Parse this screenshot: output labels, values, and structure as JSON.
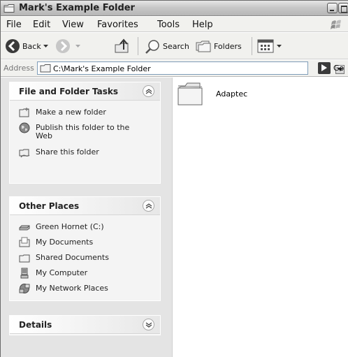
{
  "window": {
    "title": "Mark's Example Folder"
  },
  "menu": {
    "items": [
      "File",
      "Edit",
      "View",
      "Favorites",
      "Tools",
      "Help"
    ]
  },
  "toolbar": {
    "back_label": "Back",
    "search_label": "Search",
    "folders_label": "Folders"
  },
  "address": {
    "label": "Address",
    "path": "C:\\Mark's Example Folder",
    "go_label": "Go"
  },
  "tasks_panel": {
    "title": "File and Folder Tasks",
    "items": [
      {
        "label": "Make a new folder",
        "icon": "new-folder-icon"
      },
      {
        "label": "Publish this folder to the",
        "label2": "Web",
        "icon": "globe-icon"
      },
      {
        "label": "Share this folder",
        "icon": "share-folder-icon"
      }
    ]
  },
  "other_places": {
    "title": "Other Places",
    "items": [
      {
        "label": "Green Hornet (C:)",
        "icon": "drive-icon"
      },
      {
        "label": "My Documents",
        "icon": "my-documents-icon"
      },
      {
        "label": "Shared Documents",
        "icon": "shared-documents-icon"
      },
      {
        "label": "My Computer",
        "icon": "my-computer-icon"
      },
      {
        "label": "My Network Places",
        "icon": "network-places-icon"
      }
    ]
  },
  "details": {
    "title": "Details"
  },
  "content": {
    "items": [
      {
        "name": "Adaptec",
        "icon": "folder-icon"
      }
    ]
  }
}
